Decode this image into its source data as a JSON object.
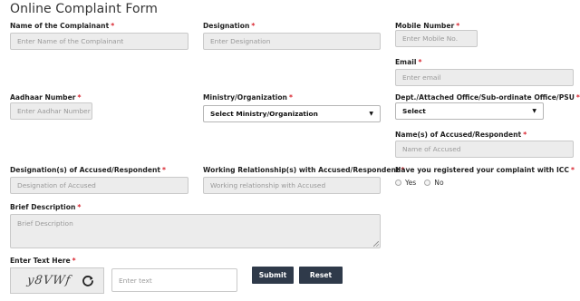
{
  "form": {
    "title": "Online Complaint Form",
    "required_mark": "*",
    "complainant_name": {
      "label": "Name of the Complainant",
      "placeholder": "Enter Name of the Complainant"
    },
    "designation": {
      "label": "Designation",
      "placeholder": "Enter Designation"
    },
    "mobile": {
      "label": "Mobile Number",
      "placeholder": "Enter Mobile No."
    },
    "email": {
      "label": "Email",
      "placeholder": "Enter email"
    },
    "aadhaar": {
      "label": "Aadhaar Number",
      "placeholder": "Enter Aadhar Number"
    },
    "ministry": {
      "label": "Ministry/Organization",
      "selected": "Select Ministry/Organization"
    },
    "dept_office": {
      "label": "Dept./Attached Office/Sub-ordinate Office/PSU",
      "selected": "Select"
    },
    "accused_names": {
      "label": "Name(s) of Accused/Respondent",
      "placeholder": "Name of Accused"
    },
    "accused_designation": {
      "label": "Designation(s) of Accused/Respondent",
      "placeholder": "Designation of Accused"
    },
    "working_relationship": {
      "label": "Working Relationship(s) with Accused/Respondent",
      "placeholder": "Working relationship with Accused"
    },
    "icc": {
      "label": "Have you registered your complaint with ICC",
      "yes_label": "Yes",
      "no_label": "No"
    },
    "brief_description": {
      "label": "Brief Description",
      "placeholder": "Brief Description"
    },
    "captcha": {
      "label": "Enter Text Here",
      "code": "y8VWf",
      "input_placeholder": "Enter text"
    },
    "buttons": {
      "submit_label": "Submit",
      "reset_label": "Reset"
    }
  }
}
